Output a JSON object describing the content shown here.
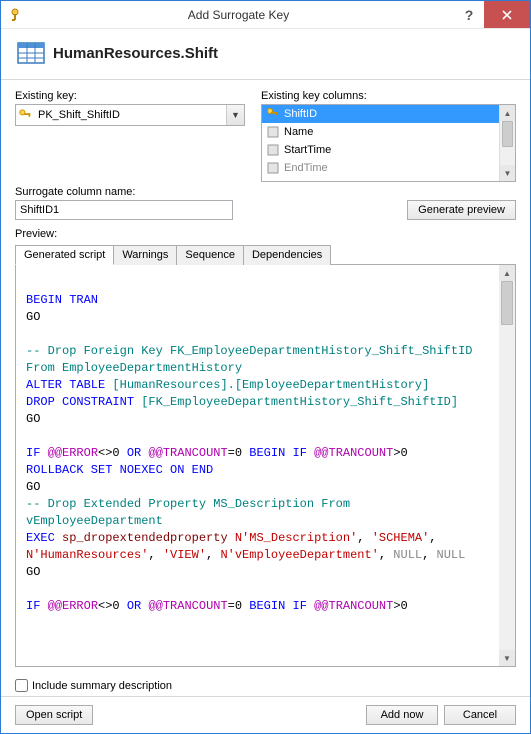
{
  "window": {
    "title": "Add Surrogate Key"
  },
  "header": {
    "title": "HumanResources.Shift"
  },
  "labels": {
    "existing_key": "Existing key:",
    "existing_columns": "Existing key columns:",
    "surrogate_name": "Surrogate column name:",
    "preview": "Preview:",
    "include_summary": "Include summary description"
  },
  "existing_key": {
    "value": "PK_Shift_ShiftID"
  },
  "columns": {
    "items": [
      {
        "name": "ShiftID",
        "selected": true,
        "icon": "key"
      },
      {
        "name": "Name",
        "selected": false,
        "icon": "col"
      },
      {
        "name": "StartTime",
        "selected": false,
        "icon": "col"
      },
      {
        "name": "EndTime",
        "selected": false,
        "icon": "col"
      }
    ]
  },
  "surrogate": {
    "value": "ShiftID1"
  },
  "buttons": {
    "generate": "Generate preview",
    "open_script": "Open script",
    "add_now": "Add now",
    "cancel": "Cancel"
  },
  "tabs": {
    "items": [
      {
        "label": "Generated script",
        "active": true
      },
      {
        "label": "Warnings",
        "active": false
      },
      {
        "label": "Sequence",
        "active": false
      },
      {
        "label": "Dependencies",
        "active": false
      }
    ]
  },
  "script": {
    "l1": "BEGIN TRAN",
    "l2": "GO",
    "l3": "-- Drop Foreign Key FK_EmployeeDepartmentHistory_Shift_ShiftID From EmployeeDepartmentHistory",
    "l4a": "ALTER TABLE",
    "l4b": "[HumanResources].[EmployeeDepartmentHistory]",
    "l5a": "DROP CONSTRAINT",
    "l5b": "[FK_EmployeeDepartmentHistory_Shift_ShiftID]",
    "l6": "GO",
    "l7a": "IF",
    "l7b": "@@ERROR",
    "l7c": "<>0",
    "l7d": "OR",
    "l7e": "@@TRANCOUNT",
    "l7f": "=0",
    "l7g": "BEGIN IF",
    "l7h": "@@TRANCOUNT",
    "l7i": ">0",
    "l8": "ROLLBACK SET NOEXEC ON END",
    "l9": "GO",
    "l10": "-- Drop Extended Property MS_Description From vEmployeeDepartment",
    "l11a": "EXEC",
    "l11b": "sp_dropextendedproperty",
    "l11c": "N'MS_Description'",
    "l11d": "'SCHEMA'",
    "l11e": "N'HumanResources'",
    "l11f": "'VIEW'",
    "l11g": "N'vEmployeeDepartment'",
    "l11h": "NULL",
    "l11i": "NULL",
    "l12": "GO"
  },
  "include_summary": {
    "checked": false
  }
}
